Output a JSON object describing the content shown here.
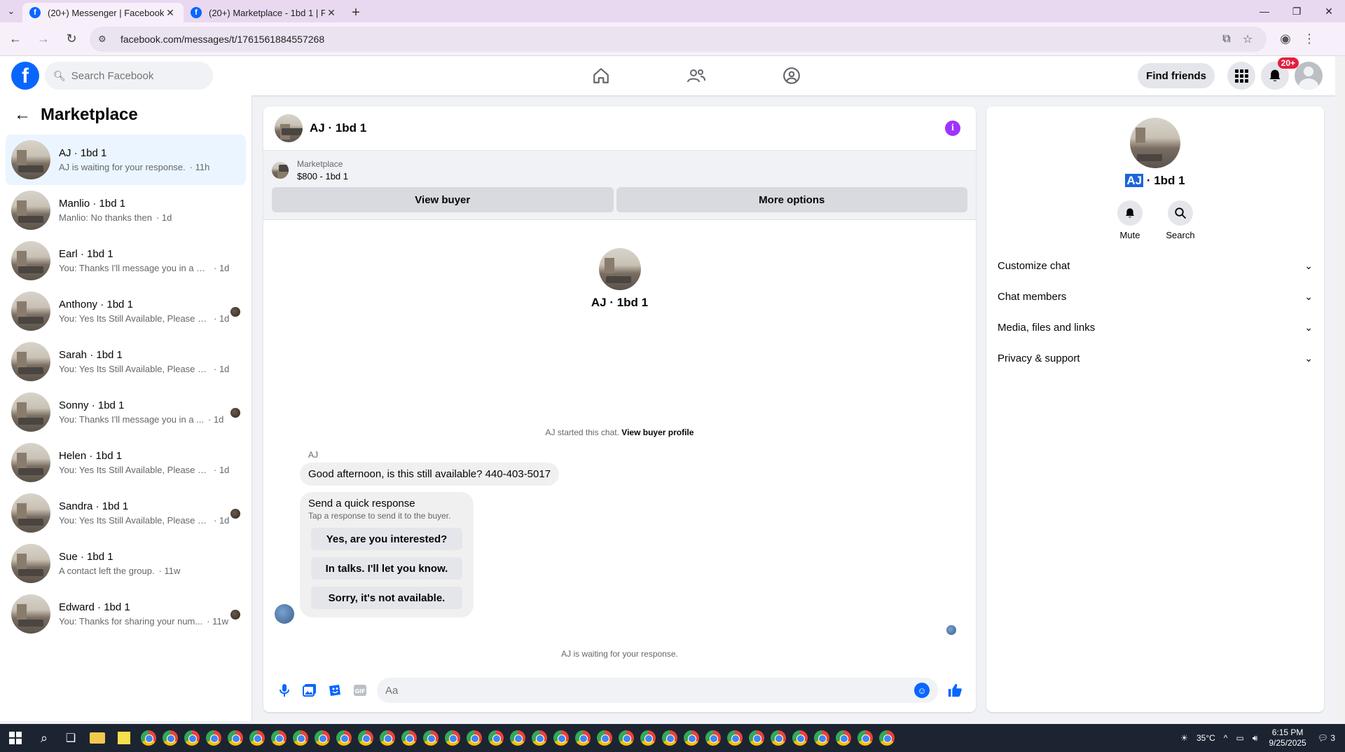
{
  "browser": {
    "tabs": [
      {
        "title": "(20+) Messenger | Facebook",
        "active": true
      },
      {
        "title": "(20+) Marketplace - 1bd 1 | Fac",
        "active": false
      }
    ],
    "url": "facebook.com/messages/t/1761561884557268"
  },
  "header": {
    "search_placeholder": "Search Facebook",
    "find_friends": "Find friends",
    "notif_badge": "20+"
  },
  "left": {
    "title": "Marketplace",
    "conversations": [
      {
        "name": "AJ · 1bd 1",
        "preview": "AJ is waiting for your response.",
        "time": "· 11h",
        "active": true,
        "seen": false
      },
      {
        "name": "Manlio · 1bd 1",
        "preview": "Manlio: No thanks then",
        "time": "· 1d",
        "active": false,
        "seen": false
      },
      {
        "name": "Earl · 1bd 1",
        "preview": "You: Thanks I'll message you in a mo...",
        "time": "· 1d",
        "active": false,
        "seen": false
      },
      {
        "name": "Anthony · 1bd 1",
        "preview": "You: Yes Its Still Available, Please Se...",
        "time": "· 1d",
        "active": false,
        "seen": true
      },
      {
        "name": "Sarah · 1bd 1",
        "preview": "You: Yes Its Still Available, Please Send...",
        "time": "· 1d",
        "active": false,
        "seen": false
      },
      {
        "name": "Sonny · 1bd 1",
        "preview": "You: Thanks I'll message you in a ...",
        "time": "· 1d",
        "active": false,
        "seen": true
      },
      {
        "name": "Helen · 1bd 1",
        "preview": "You: Yes Its Still Available, Please Send...",
        "time": "· 1d",
        "active": false,
        "seen": false
      },
      {
        "name": "Sandra · 1bd 1",
        "preview": "You: Yes Its Still Available, Please Se...",
        "time": "· 1d",
        "active": false,
        "seen": true
      },
      {
        "name": "Sue · 1bd 1",
        "preview": "A contact left the group.",
        "time": "· 11w",
        "active": false,
        "seen": false
      },
      {
        "name": "Edward · 1bd 1",
        "preview": "You: Thanks for sharing your num...",
        "time": "· 11w",
        "active": false,
        "seen": true
      }
    ]
  },
  "chat": {
    "title": "AJ · 1bd 1",
    "marketplace_label": "Marketplace",
    "listing": "$800 - 1bd 1",
    "view_buyer": "View buyer",
    "more_options": "More options",
    "profile_name": "AJ · 1bd 1",
    "started_text": "AJ started this chat.",
    "view_buyer_profile": "View buyer profile",
    "sender": "AJ",
    "message": "Good afternoon, is this still available? 440-403-5017",
    "quick_title": "Send a quick response",
    "quick_sub": "Tap a response to send it to the buyer.",
    "quick_replies": [
      "Yes, are you interested?",
      "In talks. I'll let you know.",
      "Sorry, it's not available."
    ],
    "waiting": "AJ is waiting for your response.",
    "input_placeholder": "Aa"
  },
  "info": {
    "name_highlight": "AJ",
    "name_rest": " · 1bd 1",
    "actions": [
      {
        "label": "Mute",
        "icon": "bell-icon"
      },
      {
        "label": "Search",
        "icon": "search-icon"
      }
    ],
    "sections": [
      "Customize chat",
      "Chat members",
      "Media, files and links",
      "Privacy & support"
    ]
  },
  "taskbar": {
    "temp": "35°C",
    "time": "6:15 PM",
    "date": "9/25/2025",
    "notif_count": "3"
  },
  "colors": {
    "brand": "#0866ff",
    "info": "#a033ff",
    "badge": "#e41e3f"
  }
}
